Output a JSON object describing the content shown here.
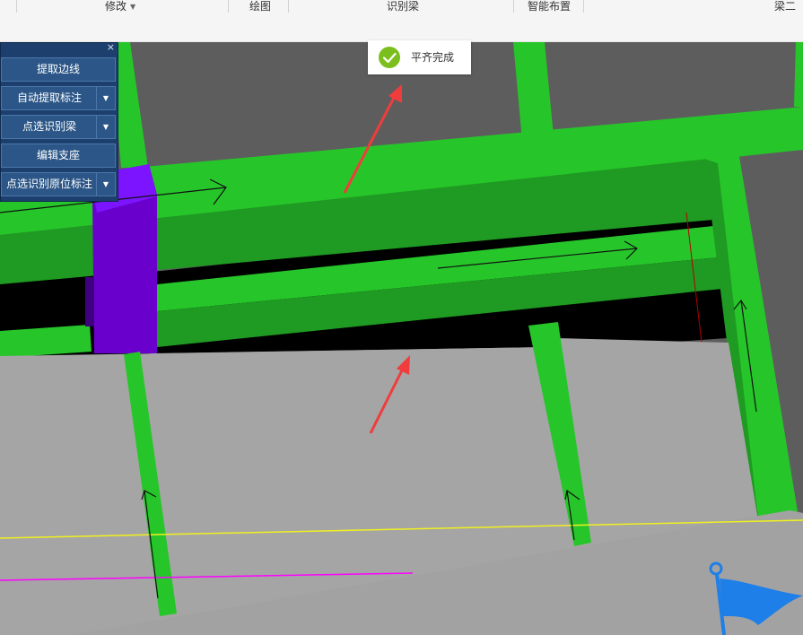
{
  "ribbon": {
    "modify_label": "修改",
    "draw_label": "绘图",
    "identify_beam_label": "识别梁",
    "smart_layout_label": "智能布置",
    "beam_secondary_label": "梁二"
  },
  "panel": {
    "close_glyph": "×",
    "items": [
      {
        "label": "提取边线"
      },
      {
        "label": "自动提取标注"
      },
      {
        "label": "点选识别梁"
      },
      {
        "label": "编辑支座"
      },
      {
        "label": "点选识别原位标注"
      }
    ]
  },
  "toast": {
    "message": "平齐完成",
    "icon": "check-circle-icon"
  },
  "colors": {
    "beam_green": "#26c62a",
    "beam_side_green": "#1f9a22",
    "column_purple": "#6a00cc",
    "slab_gray": "#a5a5a5",
    "background_gray": "#5d5d5d",
    "annotation_red": "#f03c3c",
    "flag_blue": "#1e7fe8",
    "toast_check_green": "#7bbf1e",
    "panel_blue": "#1c3f6e"
  },
  "icons": {
    "panel_close": "close-icon",
    "dropdown": "chevron-down-icon",
    "flag": "flag-icon"
  }
}
